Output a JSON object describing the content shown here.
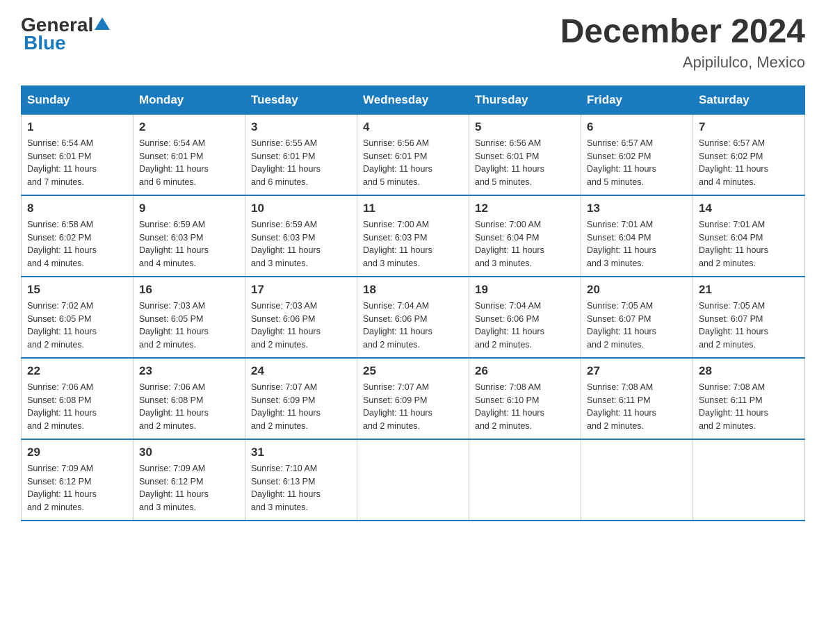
{
  "header": {
    "logo_general": "General",
    "logo_blue": "Blue",
    "month_title": "December 2024",
    "location": "Apipilulco, Mexico"
  },
  "days_of_week": [
    "Sunday",
    "Monday",
    "Tuesday",
    "Wednesday",
    "Thursday",
    "Friday",
    "Saturday"
  ],
  "weeks": [
    [
      {
        "day": "1",
        "info": "Sunrise: 6:54 AM\nSunset: 6:01 PM\nDaylight: 11 hours\nand 7 minutes."
      },
      {
        "day": "2",
        "info": "Sunrise: 6:54 AM\nSunset: 6:01 PM\nDaylight: 11 hours\nand 6 minutes."
      },
      {
        "day": "3",
        "info": "Sunrise: 6:55 AM\nSunset: 6:01 PM\nDaylight: 11 hours\nand 6 minutes."
      },
      {
        "day": "4",
        "info": "Sunrise: 6:56 AM\nSunset: 6:01 PM\nDaylight: 11 hours\nand 5 minutes."
      },
      {
        "day": "5",
        "info": "Sunrise: 6:56 AM\nSunset: 6:01 PM\nDaylight: 11 hours\nand 5 minutes."
      },
      {
        "day": "6",
        "info": "Sunrise: 6:57 AM\nSunset: 6:02 PM\nDaylight: 11 hours\nand 5 minutes."
      },
      {
        "day": "7",
        "info": "Sunrise: 6:57 AM\nSunset: 6:02 PM\nDaylight: 11 hours\nand 4 minutes."
      }
    ],
    [
      {
        "day": "8",
        "info": "Sunrise: 6:58 AM\nSunset: 6:02 PM\nDaylight: 11 hours\nand 4 minutes."
      },
      {
        "day": "9",
        "info": "Sunrise: 6:59 AM\nSunset: 6:03 PM\nDaylight: 11 hours\nand 4 minutes."
      },
      {
        "day": "10",
        "info": "Sunrise: 6:59 AM\nSunset: 6:03 PM\nDaylight: 11 hours\nand 3 minutes."
      },
      {
        "day": "11",
        "info": "Sunrise: 7:00 AM\nSunset: 6:03 PM\nDaylight: 11 hours\nand 3 minutes."
      },
      {
        "day": "12",
        "info": "Sunrise: 7:00 AM\nSunset: 6:04 PM\nDaylight: 11 hours\nand 3 minutes."
      },
      {
        "day": "13",
        "info": "Sunrise: 7:01 AM\nSunset: 6:04 PM\nDaylight: 11 hours\nand 3 minutes."
      },
      {
        "day": "14",
        "info": "Sunrise: 7:01 AM\nSunset: 6:04 PM\nDaylight: 11 hours\nand 2 minutes."
      }
    ],
    [
      {
        "day": "15",
        "info": "Sunrise: 7:02 AM\nSunset: 6:05 PM\nDaylight: 11 hours\nand 2 minutes."
      },
      {
        "day": "16",
        "info": "Sunrise: 7:03 AM\nSunset: 6:05 PM\nDaylight: 11 hours\nand 2 minutes."
      },
      {
        "day": "17",
        "info": "Sunrise: 7:03 AM\nSunset: 6:06 PM\nDaylight: 11 hours\nand 2 minutes."
      },
      {
        "day": "18",
        "info": "Sunrise: 7:04 AM\nSunset: 6:06 PM\nDaylight: 11 hours\nand 2 minutes."
      },
      {
        "day": "19",
        "info": "Sunrise: 7:04 AM\nSunset: 6:06 PM\nDaylight: 11 hours\nand 2 minutes."
      },
      {
        "day": "20",
        "info": "Sunrise: 7:05 AM\nSunset: 6:07 PM\nDaylight: 11 hours\nand 2 minutes."
      },
      {
        "day": "21",
        "info": "Sunrise: 7:05 AM\nSunset: 6:07 PM\nDaylight: 11 hours\nand 2 minutes."
      }
    ],
    [
      {
        "day": "22",
        "info": "Sunrise: 7:06 AM\nSunset: 6:08 PM\nDaylight: 11 hours\nand 2 minutes."
      },
      {
        "day": "23",
        "info": "Sunrise: 7:06 AM\nSunset: 6:08 PM\nDaylight: 11 hours\nand 2 minutes."
      },
      {
        "day": "24",
        "info": "Sunrise: 7:07 AM\nSunset: 6:09 PM\nDaylight: 11 hours\nand 2 minutes."
      },
      {
        "day": "25",
        "info": "Sunrise: 7:07 AM\nSunset: 6:09 PM\nDaylight: 11 hours\nand 2 minutes."
      },
      {
        "day": "26",
        "info": "Sunrise: 7:08 AM\nSunset: 6:10 PM\nDaylight: 11 hours\nand 2 minutes."
      },
      {
        "day": "27",
        "info": "Sunrise: 7:08 AM\nSunset: 6:11 PM\nDaylight: 11 hours\nand 2 minutes."
      },
      {
        "day": "28",
        "info": "Sunrise: 7:08 AM\nSunset: 6:11 PM\nDaylight: 11 hours\nand 2 minutes."
      }
    ],
    [
      {
        "day": "29",
        "info": "Sunrise: 7:09 AM\nSunset: 6:12 PM\nDaylight: 11 hours\nand 2 minutes."
      },
      {
        "day": "30",
        "info": "Sunrise: 7:09 AM\nSunset: 6:12 PM\nDaylight: 11 hours\nand 3 minutes."
      },
      {
        "day": "31",
        "info": "Sunrise: 7:10 AM\nSunset: 6:13 PM\nDaylight: 11 hours\nand 3 minutes."
      },
      {
        "day": "",
        "info": ""
      },
      {
        "day": "",
        "info": ""
      },
      {
        "day": "",
        "info": ""
      },
      {
        "day": "",
        "info": ""
      }
    ]
  ]
}
